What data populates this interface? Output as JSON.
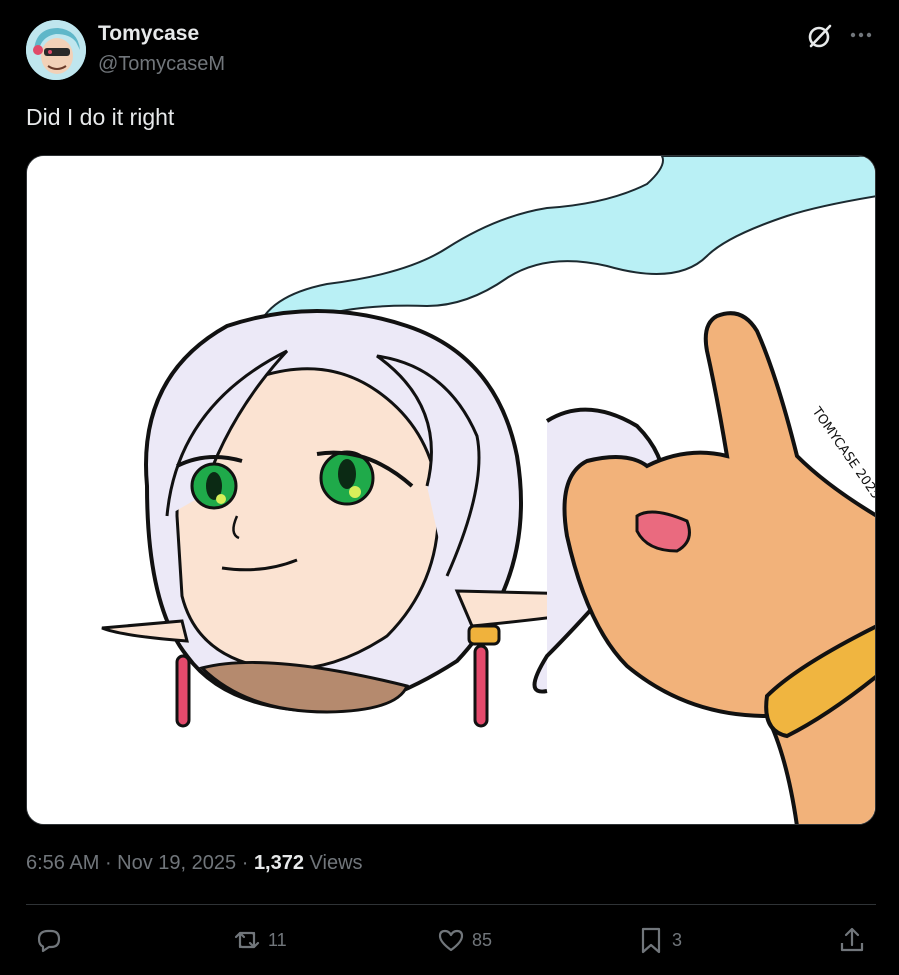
{
  "author": {
    "display_name": "Tomycase",
    "handle": "@TomycaseM",
    "avatar_icon": "avatar-character"
  },
  "tweet": {
    "text": "Did I do it right",
    "media_description_icon": "illustration-image"
  },
  "meta": {
    "time": "6:56 AM",
    "separator1": " · ",
    "date": "Nov 19, 2025",
    "separator2": " · ",
    "views_count": "1,372",
    "views_label": " Views"
  },
  "actions": {
    "reply_count": "",
    "repost_count": "11",
    "like_count": "85",
    "bookmark_count": "3"
  },
  "colors": {
    "background": "#000000",
    "text_primary": "#e7e9ea",
    "text_secondary": "#71767b",
    "divider": "#2f3336"
  }
}
